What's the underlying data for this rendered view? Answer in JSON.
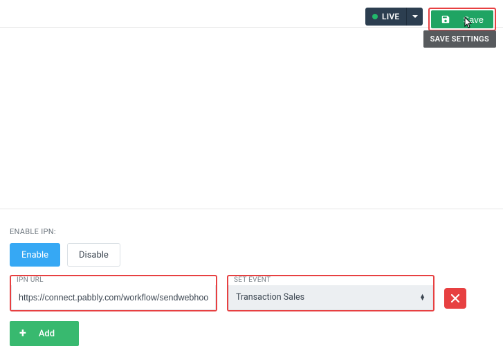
{
  "toolbar": {
    "mode_label": "LIVE",
    "save_label": "Save",
    "save_tooltip": "SAVE SETTINGS"
  },
  "ipn": {
    "section_label": "ENABLE IPN:",
    "enable_label": "Enable",
    "disable_label": "Disable",
    "url_label": "IPN URL",
    "url_value": "https://connect.pabbly.com/workflow/sendwebhookdata",
    "event_label": "SET EVENT",
    "event_value": "Transaction Sales",
    "add_label": "Add"
  },
  "colors": {
    "highlight_border": "#e74041",
    "primary_green": "#1fa463",
    "cta_green": "#38b96f",
    "blue": "#36a8f4",
    "navy": "#2c3e50"
  }
}
